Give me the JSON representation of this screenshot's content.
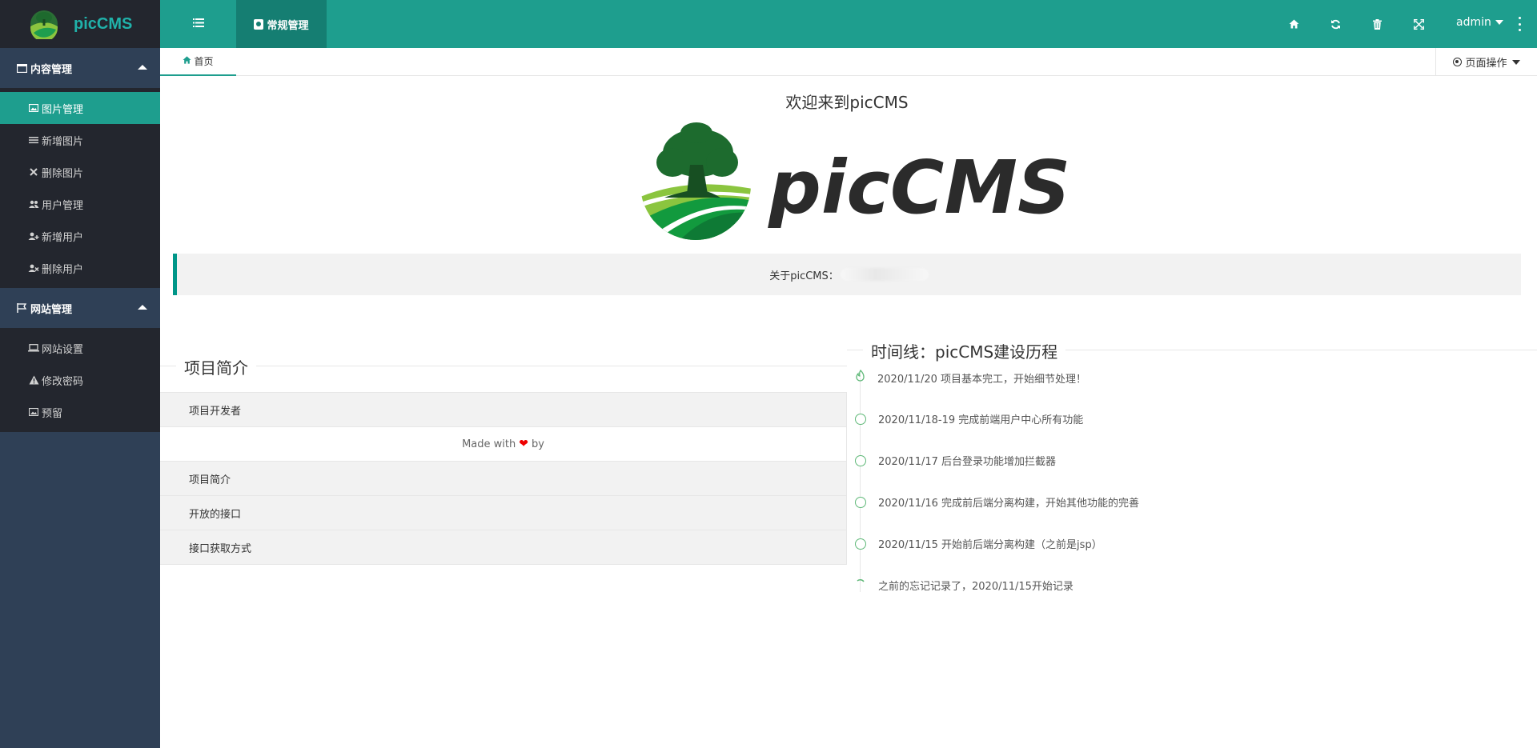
{
  "app": {
    "brand": "picCMS"
  },
  "sidebar": {
    "groups": [
      {
        "label": "内容管理",
        "items": [
          {
            "label": "图片管理",
            "icon": "image-icon",
            "active": true
          },
          {
            "label": "新增图片",
            "icon": "list-icon"
          },
          {
            "label": "删除图片",
            "icon": "close-icon"
          },
          {
            "label": "用户管理",
            "icon": "users-icon"
          },
          {
            "label": "新增用户",
            "icon": "user-add-icon"
          },
          {
            "label": "删除用户",
            "icon": "user-remove-icon"
          }
        ]
      },
      {
        "label": "网站管理",
        "items": [
          {
            "label": "网站设置",
            "icon": "laptop-icon"
          },
          {
            "label": "修改密码",
            "icon": "warning-icon"
          },
          {
            "label": "预留",
            "icon": "image-icon"
          }
        ]
      }
    ]
  },
  "header": {
    "top_tab": "常规管理",
    "user": "admin",
    "icons": [
      "home-icon",
      "refresh-icon",
      "trash-icon",
      "fullscreen-icon"
    ]
  },
  "tabs": {
    "home": "首页",
    "page_ops": "页面操作"
  },
  "main": {
    "welcome": "欢迎来到picCMS",
    "logo_text": "picCMS",
    "about_label": "关于picCMS："
  },
  "project": {
    "legend": "项目简介",
    "rows": {
      "developer": "项目开发者",
      "made_with_prefix": "Made with",
      "made_with_suffix": "by",
      "intro": "项目简介",
      "open_api": "开放的接口",
      "api_access": "接口获取方式"
    }
  },
  "timeline": {
    "legend": "时间线：picCMS建设历程",
    "items": [
      "2020/11/20 项目基本完工，开始细节处理！",
      "2020/11/18-19 完成前端用户中心所有功能",
      "2020/11/17 后台登录功能增加拦截器",
      "2020/11/16 完成前后端分离构建，开始其他功能的完善",
      "2020/11/15 开始前后端分离构建（之前是jsp）",
      "之前的忘记记录了，2020/11/15开始记录"
    ]
  },
  "colors": {
    "accent": "#1e9e8e",
    "sidebar_bg": "#2f4056",
    "sidebar_dark": "#23262e",
    "timeline_green": "#5fb878"
  }
}
